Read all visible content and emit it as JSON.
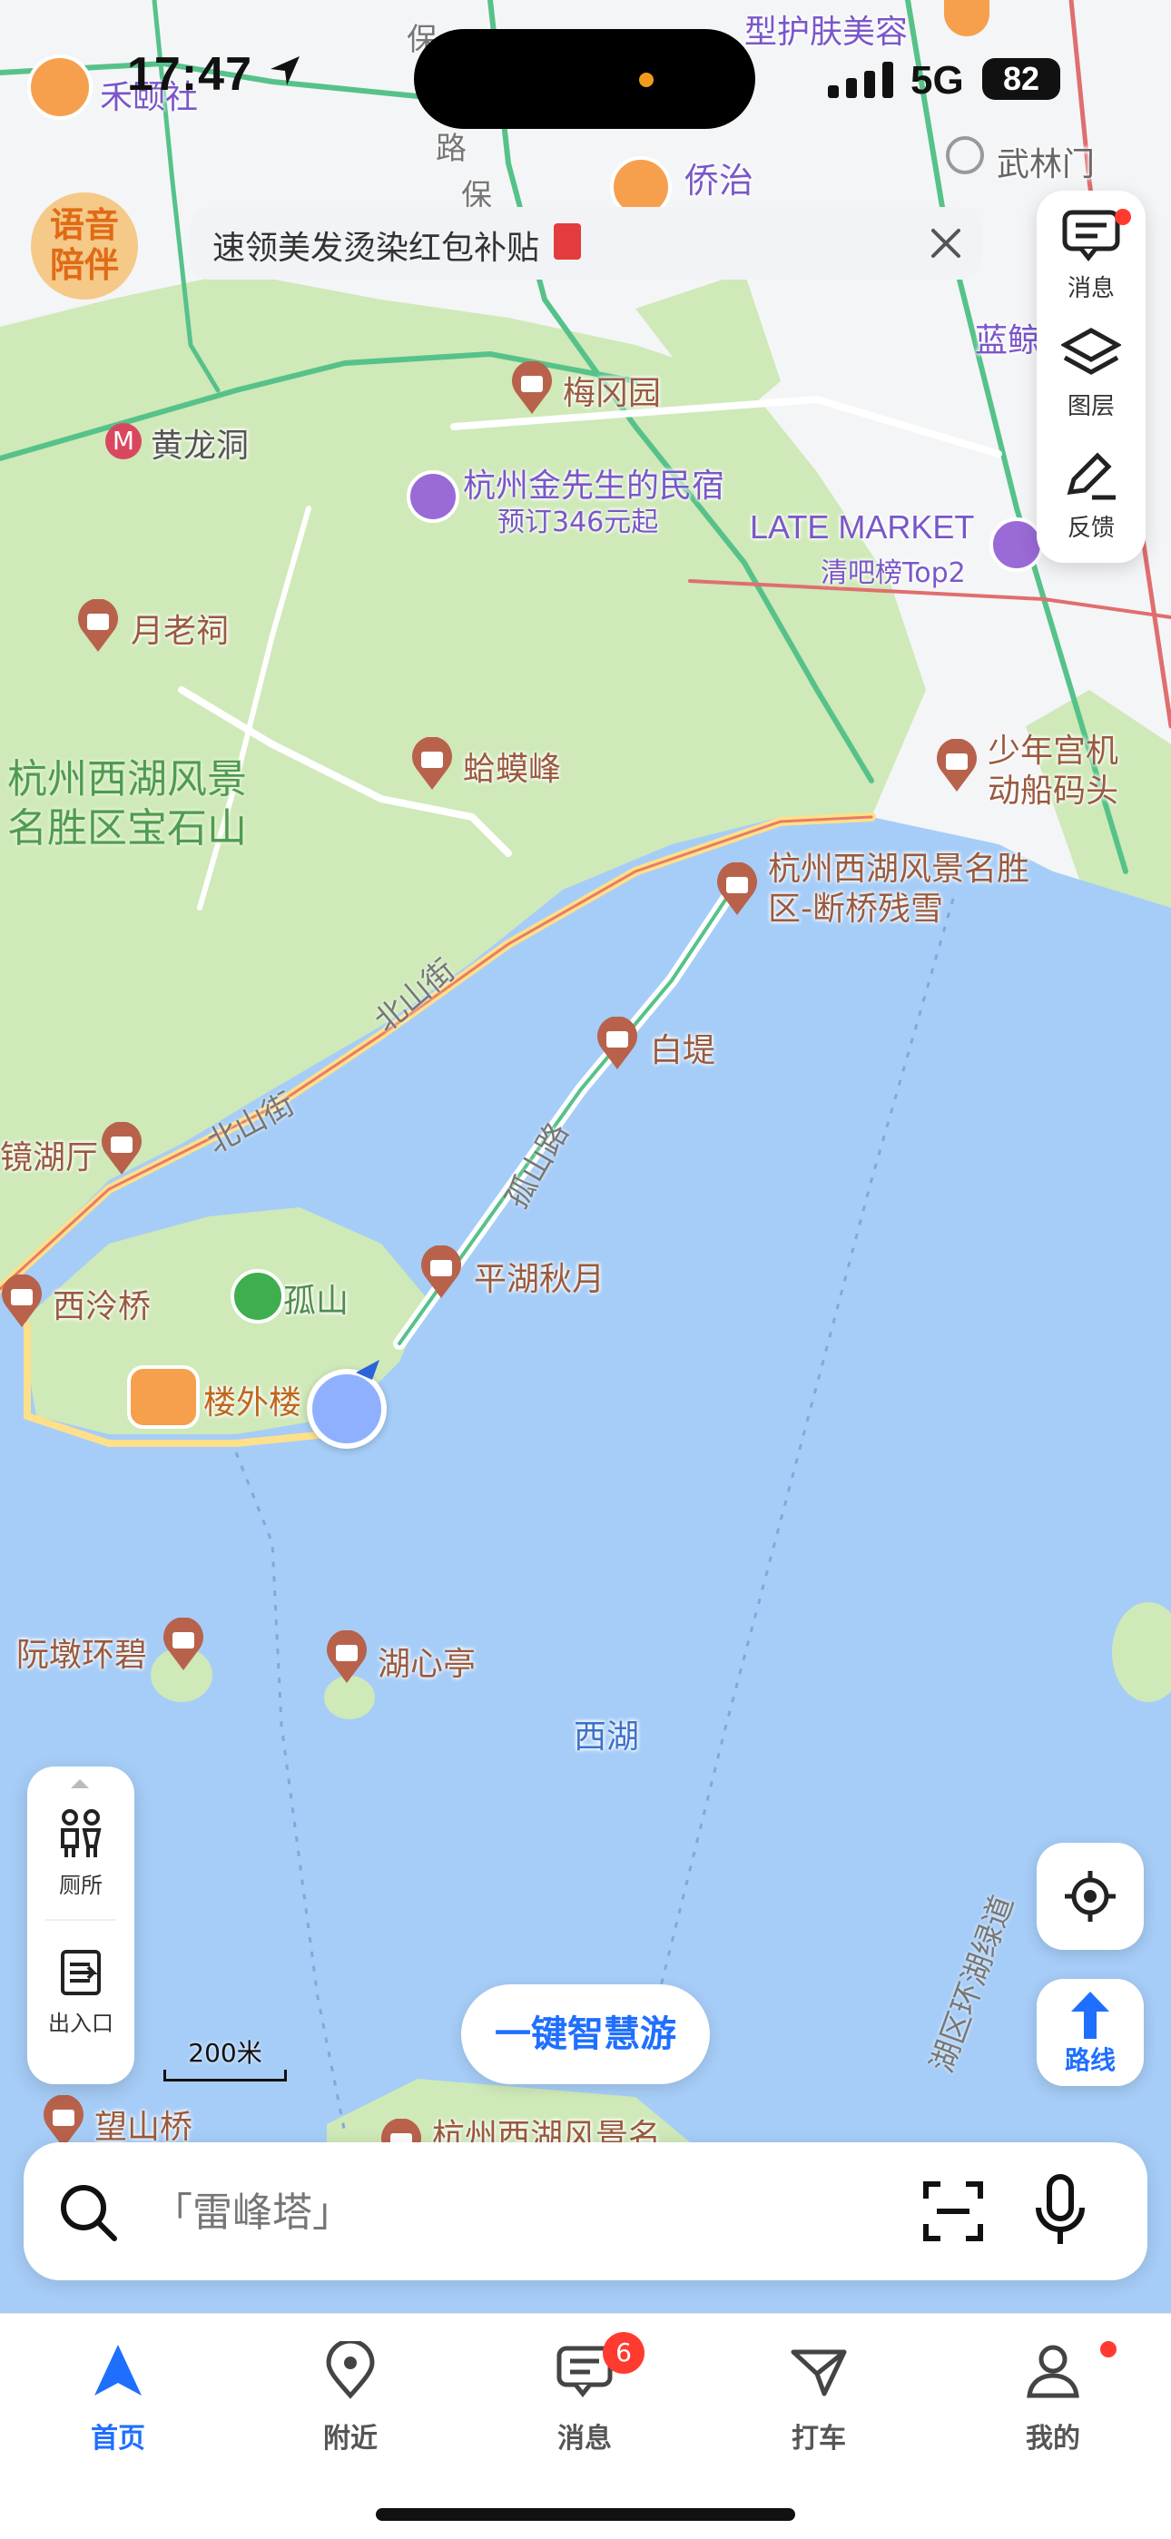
{
  "status_bar": {
    "time": "17:47",
    "network": "5G",
    "battery": "82"
  },
  "notice": {
    "text": "速领美发烫染红包补贴"
  },
  "voice_badge": {
    "line1": "语音",
    "line2": "陪伴"
  },
  "right_panel": {
    "items": [
      {
        "label": "消息",
        "icon": "message-icon"
      },
      {
        "label": "图层",
        "icon": "layers-icon"
      },
      {
        "label": "反馈",
        "icon": "feedback-edit-icon"
      }
    ]
  },
  "map": {
    "pois": [
      {
        "name": "禾颐社",
        "icon": "avatar-pin"
      },
      {
        "name": "型护肤美容",
        "icon": "avatar-pin"
      },
      {
        "name": "侨治",
        "icon": "avatar-pin"
      },
      {
        "name": "武林门",
        "icon": "metro-icon"
      },
      {
        "name": "黄龙洞",
        "icon": "metro-icon"
      },
      {
        "name": "梅冈园",
        "icon": "attraction-pin"
      },
      {
        "name": "杭州金先生的民宿",
        "sub": "预订346元起",
        "icon": "hotel-pin"
      },
      {
        "name": "LATE MARKET",
        "sub": "清吧榜Top2",
        "icon": "bar-pin"
      },
      {
        "name": "蓝鲸",
        "icon": "text"
      },
      {
        "name": "月老祠",
        "icon": "attraction-pin"
      },
      {
        "name": "蛤蟆峰",
        "icon": "attraction-pin"
      },
      {
        "name": "杭州西湖风景名胜区宝石山",
        "icon": "area-label"
      },
      {
        "name": "少年宫机动船码头",
        "icon": "attraction-pin"
      },
      {
        "name": "杭州西湖风景名胜区-断桥残雪",
        "icon": "attraction-pin"
      },
      {
        "name": "白堤",
        "icon": "attraction-pin"
      },
      {
        "name": "镜湖厅",
        "icon": "attraction-pin"
      },
      {
        "name": "西泠桥",
        "icon": "attraction-pin"
      },
      {
        "name": "孤山",
        "icon": "mountain-pin"
      },
      {
        "name": "平湖秋月",
        "icon": "attraction-pin"
      },
      {
        "name": "楼外楼",
        "icon": "restaurant-pin"
      },
      {
        "name": "阮墩环碧",
        "icon": "attraction-pin"
      },
      {
        "name": "湖心亭",
        "icon": "attraction-pin"
      },
      {
        "name": "西湖",
        "icon": "water-label"
      },
      {
        "name": "望山桥",
        "icon": "attraction-pin"
      },
      {
        "name": "杭州西湖风景名",
        "icon": "attraction-pin"
      }
    ],
    "streets": [
      "北山街",
      "北山街",
      "孤山路",
      "保",
      "路",
      "保",
      "湖区环湖绿道"
    ],
    "scale": "200米"
  },
  "left_panel": {
    "items": [
      {
        "label": "厕所",
        "icon": "toilet-icon"
      },
      {
        "label": "出入口",
        "icon": "entrance-icon"
      }
    ]
  },
  "smart_tour_button": "一键智慧游",
  "route_button": "路线",
  "search": {
    "placeholder": "「雷峰塔」"
  },
  "tabs": [
    {
      "label": "首页",
      "icon": "navigation-arrow-icon",
      "active": true
    },
    {
      "label": "附近",
      "icon": "location-pin-icon"
    },
    {
      "label": "消息",
      "icon": "message-icon",
      "badge": "6"
    },
    {
      "label": "打车",
      "icon": "taxi-icon"
    },
    {
      "label": "我的",
      "icon": "profile-icon"
    }
  ],
  "colors": {
    "accent": "#1f6fff",
    "water": "#a6cdf7",
    "park": "#cfe9b8",
    "road_green": "#56c28a",
    "pin_brown": "#b8624c",
    "badge_red": "#ff3b30"
  }
}
